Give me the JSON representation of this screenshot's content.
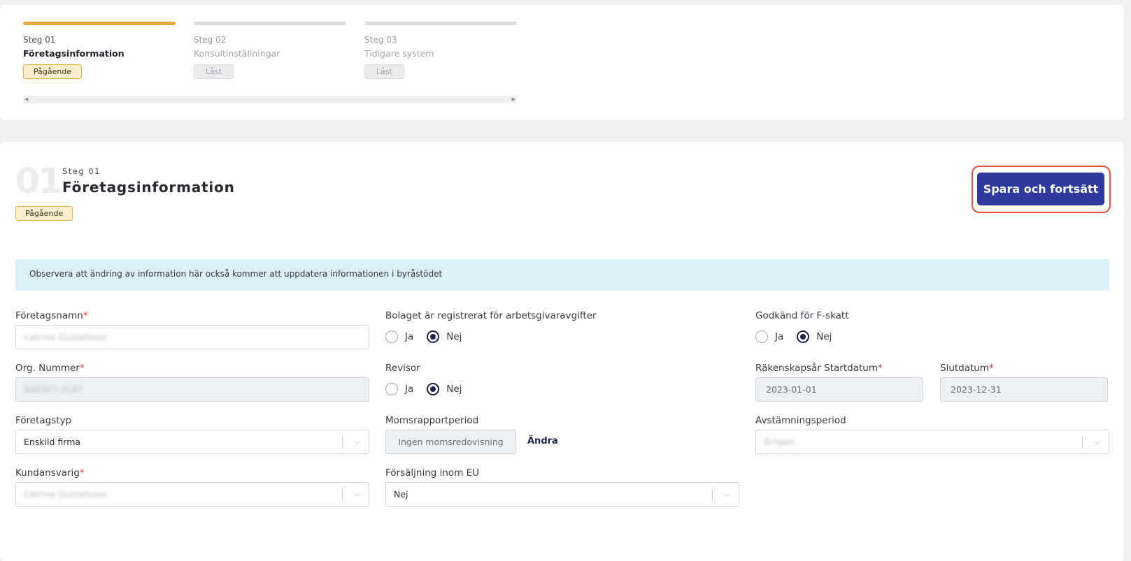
{
  "stepper": {
    "steps": [
      {
        "num": "Steg 01",
        "title": "Företagsinformation",
        "status": "Pågående"
      },
      {
        "num": "Steg 02",
        "title": "Konsultinställningar",
        "status": "Låst"
      },
      {
        "num": "Steg 03",
        "title": "Tidigare system",
        "status": "Låst"
      }
    ],
    "scroll_left": "◀",
    "scroll_right": "▶"
  },
  "section": {
    "number": "01",
    "step_label": "Steg 01",
    "title": "Företagsinformation",
    "status": "Pågående",
    "save_button": "Spara och fortsätt"
  },
  "info_message": "Observera att ändring av information här också kommer att uppdatera informationen i byråstödet",
  "form": {
    "company_name": {
      "label": "Företagsnamn",
      "required": "*",
      "value": "Catrine Gustafsson"
    },
    "org_number": {
      "label": "Org. Nummer",
      "required": "*",
      "value": "860307-3187"
    },
    "company_type": {
      "label": "Företagstyp",
      "value": "Enskild firma"
    },
    "account_manager": {
      "label": "Kundansvarig",
      "required": "*",
      "value": "Catrine Gustafsson"
    },
    "employer_registered": {
      "label": "Bolaget är registrerat för arbetsgivaravgifter",
      "yes": "Ja",
      "no": "Nej",
      "selected": "Nej"
    },
    "auditor": {
      "label": "Revisor",
      "yes": "Ja",
      "no": "Nej",
      "selected": "Nej"
    },
    "vat_period": {
      "label": "Momsrapportperiod",
      "value": "Ingen momsredovisning",
      "change_link": "Ändra"
    },
    "eu_sales": {
      "label": "Försäljning inom EU",
      "value": "Nej"
    },
    "f_tax": {
      "label": "Godkänd för F-skatt",
      "yes": "Ja",
      "no": "Nej",
      "selected": "Nej"
    },
    "fiscal_start": {
      "label": "Räkenskapsår Startdatum",
      "required": "*",
      "value": "2023-01-01"
    },
    "fiscal_end": {
      "label": "Slutdatum",
      "required": "*",
      "value": "2023-12-31"
    },
    "reconciliation_period": {
      "label": "Avstämningsperiod",
      "value": "Årligen"
    }
  },
  "icons": {
    "chevron": "⌵"
  },
  "colors": {
    "primary": "#2e3a9e",
    "progress": "#e8a93a",
    "highlight": "#e0503b"
  }
}
